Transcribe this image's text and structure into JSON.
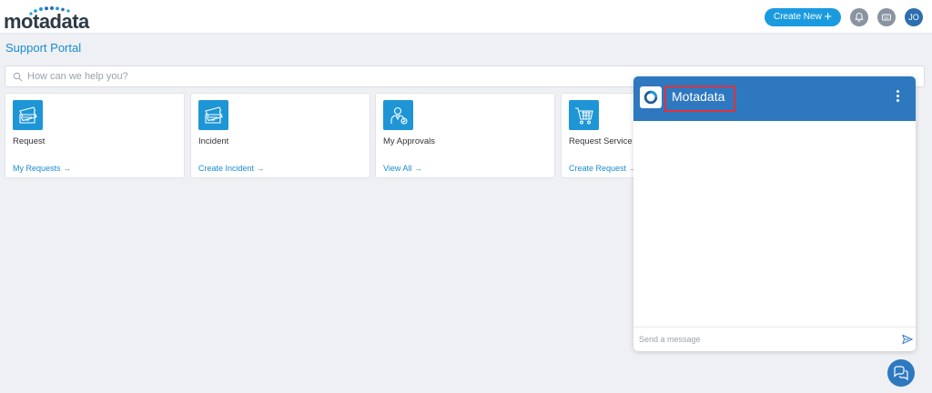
{
  "header": {
    "logo_text": "motadata",
    "create_new_label": "Create New",
    "create_new_icon": "plus-icon",
    "notifications_icon": "bell-icon",
    "keyboard_icon": "keyboard-icon",
    "avatar_initials": "JO"
  },
  "page": {
    "title": "Support Portal"
  },
  "search": {
    "placeholder": "How can we help you?",
    "value": "",
    "icon": "search-icon"
  },
  "cards": [
    {
      "title": "Request",
      "link": "My Requests →",
      "icon": "ticket-icon"
    },
    {
      "title": "Incident",
      "link": "Create Incident →",
      "icon": "ticket-icon"
    },
    {
      "title": "My Approvals",
      "link": "View All →",
      "icon": "approver-icon"
    },
    {
      "title": "Request Service",
      "link": "Create Request →",
      "icon": "cart-icon"
    }
  ],
  "chat": {
    "brand": "Motadata",
    "menu_icon": "kebab-menu-icon",
    "message_placeholder": "Send a message",
    "message_value": "",
    "send_icon": "send-icon"
  },
  "chat_launcher": {
    "icon": "chat-bubbles-icon"
  },
  "colors": {
    "accent": "#1a9be0",
    "chat_header": "#2e78c0",
    "highlight_box": "#e0313a",
    "page_bg": "#eef0f4"
  }
}
